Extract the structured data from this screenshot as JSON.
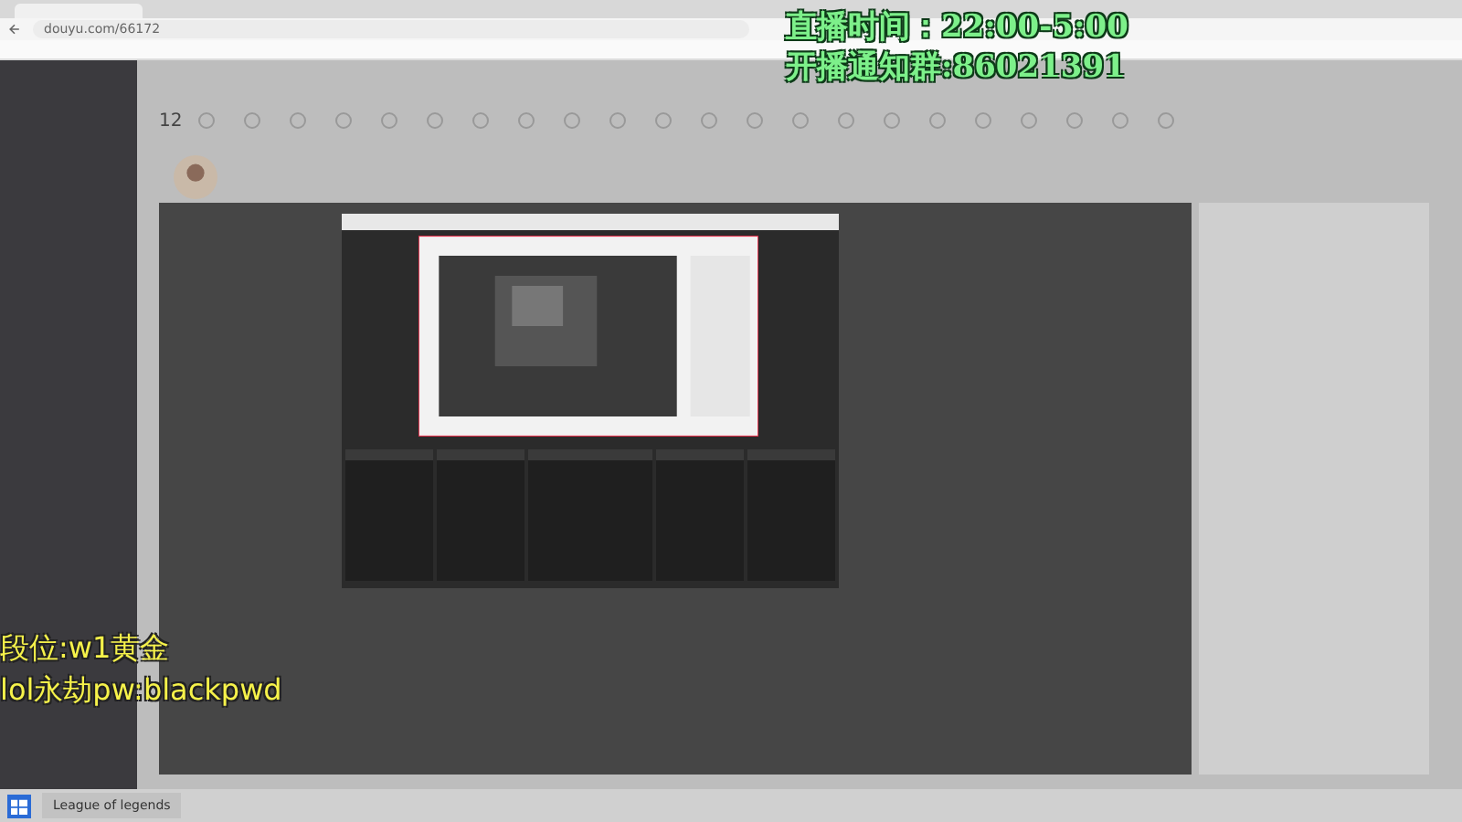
{
  "browser": {
    "address": "douyu.com/66172"
  },
  "follow_count": "12",
  "overlay": {
    "schedule": "直播时间：22:00-5:00",
    "group": "开播通知群:86021391",
    "rank": "段位:w1黄金",
    "account": "lol永劫pw:blackpwd"
  },
  "taskbar": {
    "apps": [
      "League of legends"
    ]
  }
}
